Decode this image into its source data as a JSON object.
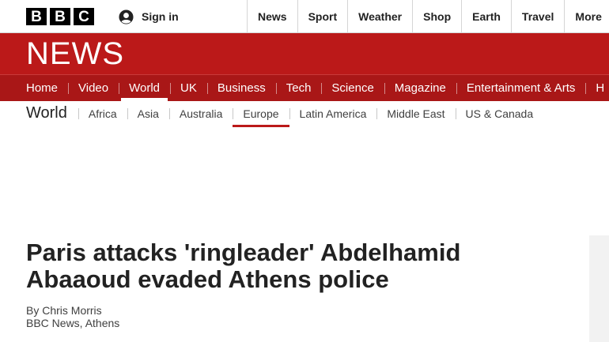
{
  "brand": {
    "logo_letters": [
      "B",
      "B",
      "C"
    ],
    "section_title": "NEWS",
    "accent_color": "#bb1919"
  },
  "account": {
    "icon": "user-icon",
    "signin_label": "Sign in"
  },
  "top_nav": {
    "items": [
      {
        "label": "News"
      },
      {
        "label": "Sport"
      },
      {
        "label": "Weather"
      },
      {
        "label": "Shop"
      },
      {
        "label": "Earth"
      },
      {
        "label": "Travel"
      },
      {
        "label": "More"
      }
    ]
  },
  "section_nav": {
    "active": "World",
    "items": [
      {
        "label": "Home"
      },
      {
        "label": "Video"
      },
      {
        "label": "World"
      },
      {
        "label": "UK"
      },
      {
        "label": "Business"
      },
      {
        "label": "Tech"
      },
      {
        "label": "Science"
      },
      {
        "label": "Magazine"
      },
      {
        "label": "Entertainment & Arts"
      },
      {
        "label": "H"
      }
    ]
  },
  "sub_nav": {
    "title": "World",
    "active": "Europe",
    "items": [
      {
        "label": "Africa"
      },
      {
        "label": "Asia"
      },
      {
        "label": "Australia"
      },
      {
        "label": "Europe"
      },
      {
        "label": "Latin America"
      },
      {
        "label": "Middle East"
      },
      {
        "label": "US & Canada"
      }
    ]
  },
  "article": {
    "headline": "Paris attacks 'ringleader' Abdelhamid Abaaoud evaded Athens police",
    "author": "By Chris Morris",
    "location": "BBC News, Athens"
  }
}
